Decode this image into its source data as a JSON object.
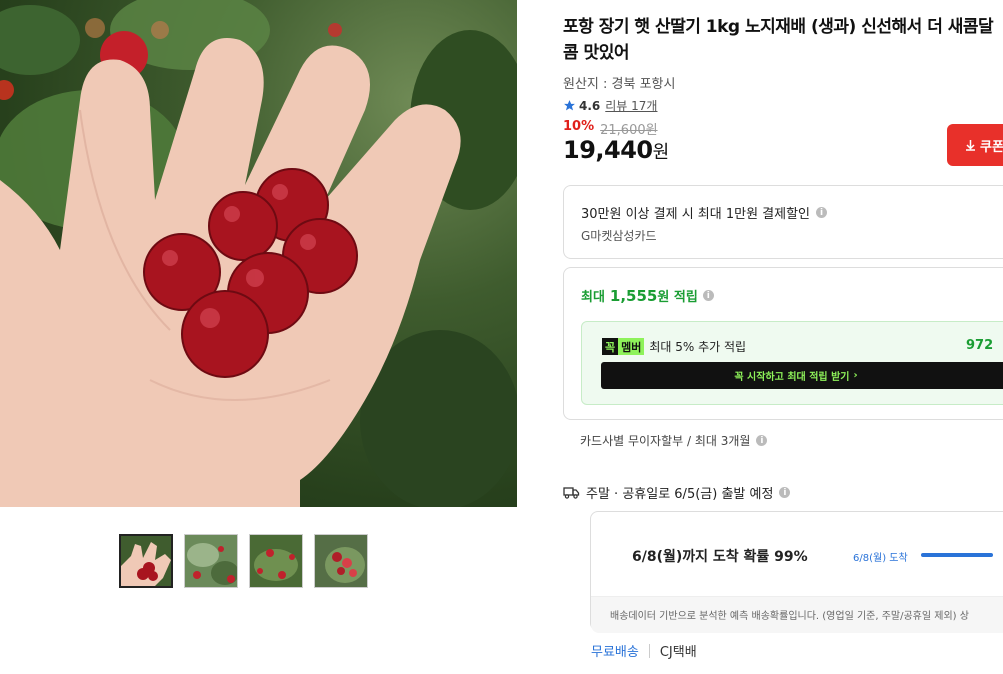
{
  "product": {
    "title": "포항 장기 햇 산딸기 1kg 노지재배 (생과) 신선해서 더 새콤달콤 맛있어",
    "origin": "원산지 : 경북 포항시",
    "rating": "4.6",
    "review_link": "리뷰 17개",
    "discount_rate": "10%",
    "original_price": "21,600원",
    "price_number": "19,440",
    "price_unit": "원",
    "coupon_button": "쿠폰"
  },
  "card_promo": {
    "headline": "30만원 이상 결제 시 최대 1만원 결제할인",
    "card_name": "G마켓삼성카드"
  },
  "points": {
    "prefix": "최대",
    "amount": "1,555",
    "suffix": "원 적립",
    "member_logo_left": "꼭",
    "member_logo_right": "멤버",
    "member_text": "최대 5% 추가 적립",
    "member_amount": "972",
    "member_cta": "꼭 시작하고 최대 적립 받기"
  },
  "installment": "카드사별 무이자할부 / 최대 3개월",
  "shipping": {
    "schedule": "주말 · 공휴일로 6/5(금) 출발 예정",
    "arrival_main": "6/8(월)까지 도착 확률 99%",
    "arrival_date": "6/8(월) 도착",
    "arrival_probability": 0.99,
    "note": "배송데이터 기반으로 분석한 예측 배송확률입니다. (영업일 기준, 주말/공휴일 제외) 상",
    "free_shipping": "무료배송",
    "courier": "CJ택배"
  },
  "gallery": {
    "thumbnails": [
      "berries-in-hand",
      "berries-on-bush",
      "berries-cluster",
      "berries-close-up"
    ],
    "active_index": 0
  },
  "colors": {
    "accent_red": "#e8302a",
    "point_green": "#1a9d33",
    "member_lime": "#8ef25a",
    "link_blue": "#2a73d8"
  }
}
